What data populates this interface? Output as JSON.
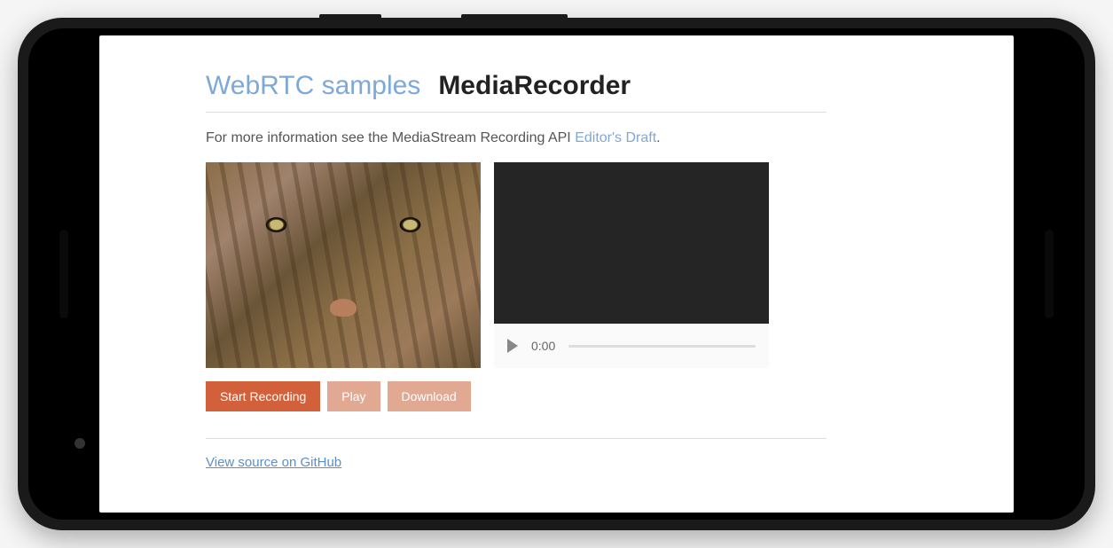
{
  "header": {
    "title_link": "WebRTC samples",
    "title_bold": "MediaRecorder"
  },
  "description": {
    "text_before": "For more information see the MediaStream Recording API ",
    "link_text": "Editor's Draft",
    "text_after": "."
  },
  "video_player": {
    "current_time": "0:00"
  },
  "buttons": {
    "start_recording": "Start Recording",
    "play": "Play",
    "download": "Download"
  },
  "footer": {
    "github_link": "View source on GitHub"
  }
}
